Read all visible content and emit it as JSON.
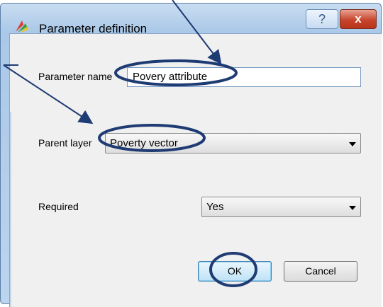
{
  "window": {
    "title": "Parameter definition",
    "help_label": "?",
    "close_label": "x"
  },
  "form": {
    "param_name_label": "Parameter name",
    "param_name_value": "Povery attribute",
    "parent_layer_label": "Parent layer",
    "parent_layer_value": "Poverty vector",
    "required_label": "Required",
    "required_value": "Yes"
  },
  "buttons": {
    "ok": "OK",
    "cancel": "Cancel"
  },
  "colors": {
    "annotation": "#1f3b73",
    "title_bg": "#aac8e8"
  },
  "icons": [
    "app-icon",
    "help-icon",
    "close-icon",
    "dropdown-arrow-icon"
  ]
}
